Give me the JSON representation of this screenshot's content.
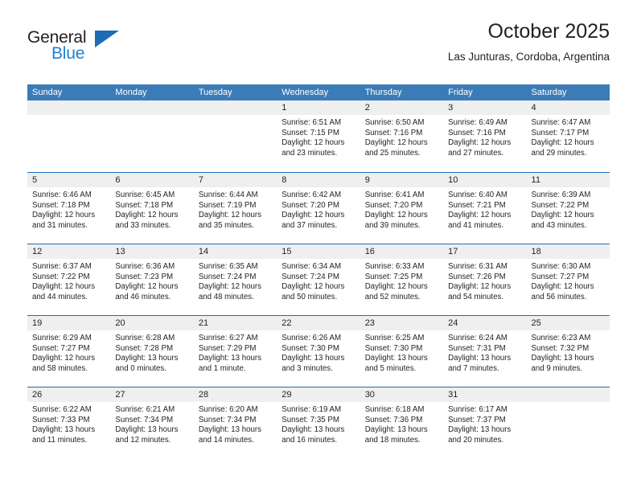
{
  "brand": {
    "name_top": "General",
    "name_bottom": "Blue",
    "triangle_icon": "blue-triangle-icon",
    "accent_color": "#1d6cb5"
  },
  "header": {
    "title": "October 2025",
    "subtitle": "Las Junturas, Cordoba, Argentina"
  },
  "colors": {
    "header_band": "#3b7cb8",
    "day_band": "#efefef",
    "week_divider": "#1d6cb5",
    "text": "#231f20",
    "brand_blue": "#1f7fd4"
  },
  "calendar": {
    "weekday_headers": [
      "Sunday",
      "Monday",
      "Tuesday",
      "Wednesday",
      "Thursday",
      "Friday",
      "Saturday"
    ],
    "weeks": [
      [
        {
          "day": "",
          "lines": []
        },
        {
          "day": "",
          "lines": []
        },
        {
          "day": "",
          "lines": []
        },
        {
          "day": "1",
          "lines": [
            "Sunrise: 6:51 AM",
            "Sunset: 7:15 PM",
            "Daylight: 12 hours",
            "and 23 minutes."
          ]
        },
        {
          "day": "2",
          "lines": [
            "Sunrise: 6:50 AM",
            "Sunset: 7:16 PM",
            "Daylight: 12 hours",
            "and 25 minutes."
          ]
        },
        {
          "day": "3",
          "lines": [
            "Sunrise: 6:49 AM",
            "Sunset: 7:16 PM",
            "Daylight: 12 hours",
            "and 27 minutes."
          ]
        },
        {
          "day": "4",
          "lines": [
            "Sunrise: 6:47 AM",
            "Sunset: 7:17 PM",
            "Daylight: 12 hours",
            "and 29 minutes."
          ]
        }
      ],
      [
        {
          "day": "5",
          "lines": [
            "Sunrise: 6:46 AM",
            "Sunset: 7:18 PM",
            "Daylight: 12 hours",
            "and 31 minutes."
          ]
        },
        {
          "day": "6",
          "lines": [
            "Sunrise: 6:45 AM",
            "Sunset: 7:18 PM",
            "Daylight: 12 hours",
            "and 33 minutes."
          ]
        },
        {
          "day": "7",
          "lines": [
            "Sunrise: 6:44 AM",
            "Sunset: 7:19 PM",
            "Daylight: 12 hours",
            "and 35 minutes."
          ]
        },
        {
          "day": "8",
          "lines": [
            "Sunrise: 6:42 AM",
            "Sunset: 7:20 PM",
            "Daylight: 12 hours",
            "and 37 minutes."
          ]
        },
        {
          "day": "9",
          "lines": [
            "Sunrise: 6:41 AM",
            "Sunset: 7:20 PM",
            "Daylight: 12 hours",
            "and 39 minutes."
          ]
        },
        {
          "day": "10",
          "lines": [
            "Sunrise: 6:40 AM",
            "Sunset: 7:21 PM",
            "Daylight: 12 hours",
            "and 41 minutes."
          ]
        },
        {
          "day": "11",
          "lines": [
            "Sunrise: 6:39 AM",
            "Sunset: 7:22 PM",
            "Daylight: 12 hours",
            "and 43 minutes."
          ]
        }
      ],
      [
        {
          "day": "12",
          "lines": [
            "Sunrise: 6:37 AM",
            "Sunset: 7:22 PM",
            "Daylight: 12 hours",
            "and 44 minutes."
          ]
        },
        {
          "day": "13",
          "lines": [
            "Sunrise: 6:36 AM",
            "Sunset: 7:23 PM",
            "Daylight: 12 hours",
            "and 46 minutes."
          ]
        },
        {
          "day": "14",
          "lines": [
            "Sunrise: 6:35 AM",
            "Sunset: 7:24 PM",
            "Daylight: 12 hours",
            "and 48 minutes."
          ]
        },
        {
          "day": "15",
          "lines": [
            "Sunrise: 6:34 AM",
            "Sunset: 7:24 PM",
            "Daylight: 12 hours",
            "and 50 minutes."
          ]
        },
        {
          "day": "16",
          "lines": [
            "Sunrise: 6:33 AM",
            "Sunset: 7:25 PM",
            "Daylight: 12 hours",
            "and 52 minutes."
          ]
        },
        {
          "day": "17",
          "lines": [
            "Sunrise: 6:31 AM",
            "Sunset: 7:26 PM",
            "Daylight: 12 hours",
            "and 54 minutes."
          ]
        },
        {
          "day": "18",
          "lines": [
            "Sunrise: 6:30 AM",
            "Sunset: 7:27 PM",
            "Daylight: 12 hours",
            "and 56 minutes."
          ]
        }
      ],
      [
        {
          "day": "19",
          "lines": [
            "Sunrise: 6:29 AM",
            "Sunset: 7:27 PM",
            "Daylight: 12 hours",
            "and 58 minutes."
          ]
        },
        {
          "day": "20",
          "lines": [
            "Sunrise: 6:28 AM",
            "Sunset: 7:28 PM",
            "Daylight: 13 hours",
            "and 0 minutes."
          ]
        },
        {
          "day": "21",
          "lines": [
            "Sunrise: 6:27 AM",
            "Sunset: 7:29 PM",
            "Daylight: 13 hours",
            "and 1 minute."
          ]
        },
        {
          "day": "22",
          "lines": [
            "Sunrise: 6:26 AM",
            "Sunset: 7:30 PM",
            "Daylight: 13 hours",
            "and 3 minutes."
          ]
        },
        {
          "day": "23",
          "lines": [
            "Sunrise: 6:25 AM",
            "Sunset: 7:30 PM",
            "Daylight: 13 hours",
            "and 5 minutes."
          ]
        },
        {
          "day": "24",
          "lines": [
            "Sunrise: 6:24 AM",
            "Sunset: 7:31 PM",
            "Daylight: 13 hours",
            "and 7 minutes."
          ]
        },
        {
          "day": "25",
          "lines": [
            "Sunrise: 6:23 AM",
            "Sunset: 7:32 PM",
            "Daylight: 13 hours",
            "and 9 minutes."
          ]
        }
      ],
      [
        {
          "day": "26",
          "lines": [
            "Sunrise: 6:22 AM",
            "Sunset: 7:33 PM",
            "Daylight: 13 hours",
            "and 11 minutes."
          ]
        },
        {
          "day": "27",
          "lines": [
            "Sunrise: 6:21 AM",
            "Sunset: 7:34 PM",
            "Daylight: 13 hours",
            "and 12 minutes."
          ]
        },
        {
          "day": "28",
          "lines": [
            "Sunrise: 6:20 AM",
            "Sunset: 7:34 PM",
            "Daylight: 13 hours",
            "and 14 minutes."
          ]
        },
        {
          "day": "29",
          "lines": [
            "Sunrise: 6:19 AM",
            "Sunset: 7:35 PM",
            "Daylight: 13 hours",
            "and 16 minutes."
          ]
        },
        {
          "day": "30",
          "lines": [
            "Sunrise: 6:18 AM",
            "Sunset: 7:36 PM",
            "Daylight: 13 hours",
            "and 18 minutes."
          ]
        },
        {
          "day": "31",
          "lines": [
            "Sunrise: 6:17 AM",
            "Sunset: 7:37 PM",
            "Daylight: 13 hours",
            "and 20 minutes."
          ]
        },
        {
          "day": "",
          "lines": []
        }
      ]
    ]
  }
}
